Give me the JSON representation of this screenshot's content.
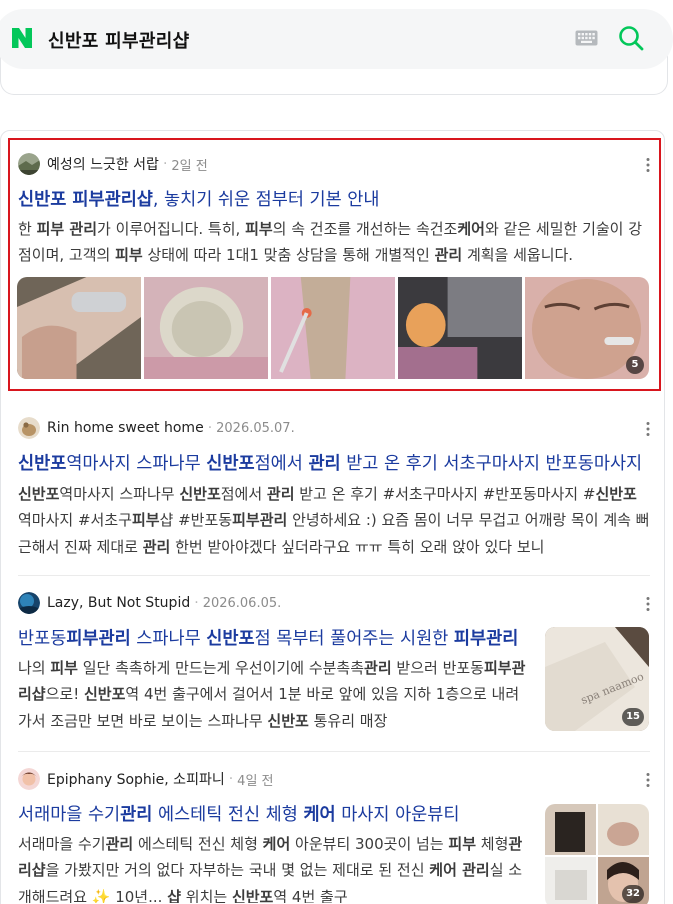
{
  "search": {
    "logo_letter": "N",
    "query": "신반포 피부관리샵",
    "brand_color": "#03c75a"
  },
  "results": [
    {
      "author": "예성의 느긋한 서랍",
      "date": "2일 전",
      "title_parts": [
        {
          "t": "신반포 피부관리샵",
          "b": true
        },
        {
          "t": ", 놓치기 쉬운 점부터 기본 안내",
          "b": false
        }
      ],
      "body_parts": [
        {
          "t": "한 ",
          "b": false
        },
        {
          "t": "피부 관리",
          "b": true
        },
        {
          "t": "가 이루어집니다. 특히, ",
          "b": false
        },
        {
          "t": "피부",
          "b": true
        },
        {
          "t": "의 속 건조를 개선하는 속건조",
          "b": false
        },
        {
          "t": "케어",
          "b": true
        },
        {
          "t": "와 같은 세밀한 기술이 강점이며, 고객의 ",
          "b": false
        },
        {
          "t": "피부",
          "b": true
        },
        {
          "t": " 상태에 따라 1대1 맞춤 상담을 통해 개별적인 ",
          "b": false
        },
        {
          "t": "관리",
          "b": true
        },
        {
          "t": " 계획을 세웁니다.",
          "b": false
        }
      ],
      "image_count": "5"
    },
    {
      "author": "Rin home sweet home",
      "date": "2026.05.07.",
      "title_parts": [
        {
          "t": "신반포",
          "b": true
        },
        {
          "t": "역마사지 스파나무 ",
          "b": false
        },
        {
          "t": "신반포",
          "b": true
        },
        {
          "t": "점에서 ",
          "b": false
        },
        {
          "t": "관리",
          "b": true
        },
        {
          "t": " 받고 온 후기 서초구마사지 반포동마사지",
          "b": false
        }
      ],
      "body_parts": [
        {
          "t": "신반포",
          "b": true
        },
        {
          "t": "역마사지 스파나무 ",
          "b": false
        },
        {
          "t": "신반포",
          "b": true
        },
        {
          "t": "점에서 ",
          "b": false
        },
        {
          "t": "관리",
          "b": true
        },
        {
          "t": " 받고 온 후기 #서초구마사지 #반포동마사지 #",
          "b": false
        },
        {
          "t": "신반포",
          "b": true
        },
        {
          "t": "역마사지 #서초구",
          "b": false
        },
        {
          "t": "피부",
          "b": true
        },
        {
          "t": "샵 #반포동",
          "b": false
        },
        {
          "t": "피부관리",
          "b": true
        },
        {
          "t": " 안녕하세요 :) 요즘 몸이 너무 무겁고 어깨랑 목이 계속 뻐근해서 진짜 제대로 ",
          "b": false
        },
        {
          "t": "관리",
          "b": true
        },
        {
          "t": " 한번 받아야겠다 싶더라구요 ㅠㅠ 특히 오래 앉아 있다 보니",
          "b": false
        }
      ]
    },
    {
      "author": "Lazy, But Not Stupid",
      "date": "2026.06.05.",
      "title_parts": [
        {
          "t": "반포동",
          "b": false
        },
        {
          "t": "피부관리",
          "b": true
        },
        {
          "t": " 스파나무 ",
          "b": false
        },
        {
          "t": "신반포",
          "b": true
        },
        {
          "t": "점 목부터 풀어주는 시원한 ",
          "b": false
        },
        {
          "t": "피부관리",
          "b": true
        }
      ],
      "body_parts": [
        {
          "t": "나의 ",
          "b": false
        },
        {
          "t": "피부",
          "b": true
        },
        {
          "t": " 일단 촉촉하게 만드는게 우선이기에 수분촉촉",
          "b": false
        },
        {
          "t": "관리",
          "b": true
        },
        {
          "t": " 받으러 반포동",
          "b": false
        },
        {
          "t": "피부관리샵",
          "b": true
        },
        {
          "t": "으로! ",
          "b": false
        },
        {
          "t": "신반포",
          "b": true
        },
        {
          "t": "역 4번 출구에서 걸어서 1분 바로 앞에 있음 지하 1층으로 내려가서 조금만 보면 바로 보이는 스파나무 ",
          "b": false
        },
        {
          "t": "신반포",
          "b": true
        },
        {
          "t": " 통유리 매장",
          "b": false
        }
      ],
      "thumb_text": "spa naamoo",
      "image_count": "15"
    },
    {
      "author": "Epiphany Sophie, 소피파니",
      "date": "4일 전",
      "title_parts": [
        {
          "t": "서래마을 수기",
          "b": false
        },
        {
          "t": "관리",
          "b": true
        },
        {
          "t": " 에스테틱 전신 체형 ",
          "b": false
        },
        {
          "t": "케어",
          "b": true
        },
        {
          "t": " 마사지 아운뷰티",
          "b": false
        }
      ],
      "body_parts": [
        {
          "t": "서래마을 수기",
          "b": false
        },
        {
          "t": "관리",
          "b": true
        },
        {
          "t": " 에스테틱 전신 체형 ",
          "b": false
        },
        {
          "t": "케어",
          "b": true
        },
        {
          "t": " 아운뷰티 300곳이 넘는 ",
          "b": false
        },
        {
          "t": "피부",
          "b": true
        },
        {
          "t": " 체형",
          "b": false
        },
        {
          "t": "관리샵",
          "b": true
        },
        {
          "t": "을 가봤지만 거의 없다 자부하는 국내 몇 없는 제대로 된 전신 ",
          "b": false
        },
        {
          "t": "케어 관리",
          "b": true
        },
        {
          "t": "실 소개해드려요 ✨ 10년... ",
          "b": false
        },
        {
          "t": "샵",
          "b": true
        },
        {
          "t": " 위치는 ",
          "b": false
        },
        {
          "t": "신반포",
          "b": true
        },
        {
          "t": "역 4번 출구",
          "b": false
        }
      ],
      "image_count": "32"
    }
  ]
}
